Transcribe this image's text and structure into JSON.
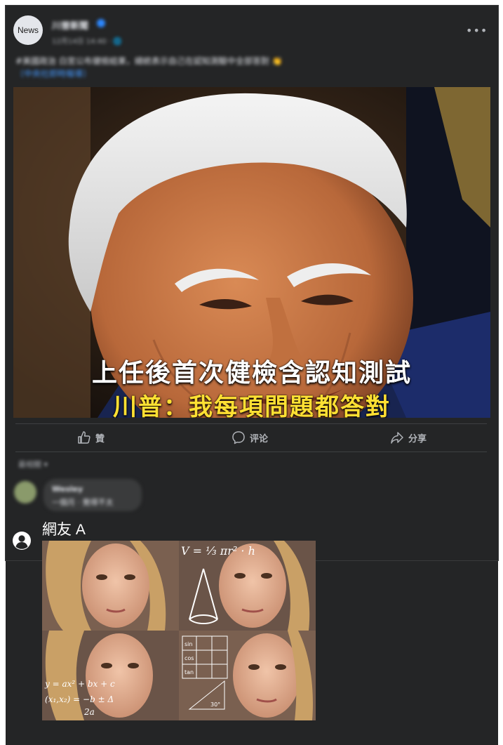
{
  "post": {
    "avatar_text": "News",
    "page_name": "川普新聞",
    "meta": "12月14日 14:40 · 🌐",
    "caption_line1": "#美國政治 白宮公布健檢結果，總統表示自己在認知測驗中全部答對 👏",
    "caption_line2": "〔中央社即時報導〕",
    "more_icon": "more-horizontal-icon",
    "headline_line1": "上任後首次健檢含認知測試",
    "headline_line2": "川普：我每項問題都答對",
    "actions": {
      "like": "贊",
      "comment": "评论",
      "share": "分享"
    }
  },
  "comments": {
    "sort_label": "最相關 ▾",
    "first": {
      "name": "Wesley",
      "text": "一個月 · 覺得不太"
    },
    "reply": {
      "user_name": "網友 A"
    }
  },
  "colors": {
    "card_bg": "#242526",
    "text_primary": "#e4e6eb",
    "text_secondary": "#b0b3b8",
    "headline_white": "#ffffff",
    "headline_yellow": "#ffe033"
  }
}
